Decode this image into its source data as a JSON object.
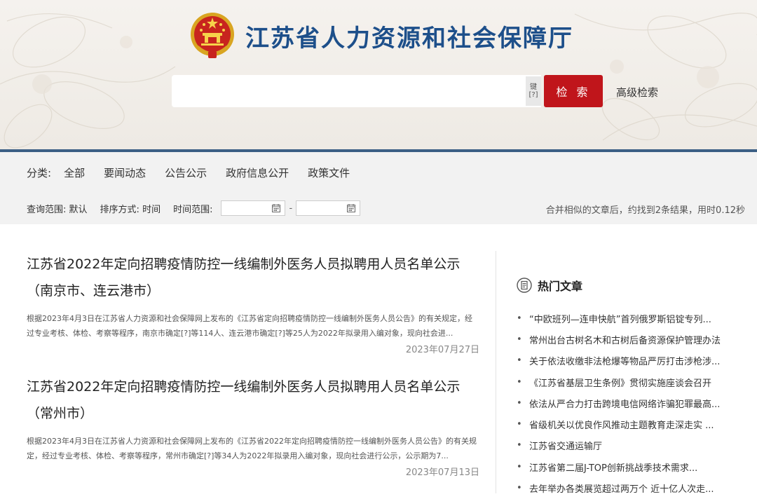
{
  "header": {
    "site_title": "江苏省人力资源和社会保障厅",
    "search_value": "",
    "keyboard_label_top": "键",
    "keyboard_label_bottom": "[?]",
    "search_button": "检 索",
    "advanced_search": "高级检索"
  },
  "filter": {
    "category_label": "分类:",
    "categories": [
      "全部",
      "要闻动态",
      "公告公示",
      "政府信息公开",
      "政策文件"
    ],
    "scope_label": "查询范围:",
    "scope_value": "默认",
    "sort_label": "排序方式:",
    "sort_value": "时间",
    "time_range_label": "时间范围:",
    "date_from": "",
    "date_to": "",
    "range_separator": "-",
    "result_summary": "合并相似的文章后，约找到2条结果，用时0.12秒"
  },
  "results": [
    {
      "title": "江苏省2022年定向招聘疫情防控一线编制外医务人员拟聘用人员名单公示（南京市、连云港市）",
      "summary": "根据2023年4月3日在江苏省人力资源和社会保障网上发布的《江苏省定向招聘疫情防控一线编制外医务人员公告》的有关规定，经过专业考核、体检、考察等程序，南京市确定[?]等114人、连云港市确定[?]等25人为2022年拟录用入编对象，现向社会进...",
      "date": "2023年07月27日"
    },
    {
      "title": "江苏省2022年定向招聘疫情防控一线编制外医务人员拟聘用人员名单公示（常州市）",
      "summary": "根据2023年4月3日在江苏省人力资源和社会保障网上发布的《江苏省2022年定向招聘疫情防控一线编制外医务人员公告》的有关规定，经过专业考核、体检、考察等程序，常州市确定[?]等34人为2022年拟录用入编对象，现向社会进行公示，公示期为7...",
      "date": "2023年07月13日"
    }
  ],
  "sidebar": {
    "hot_title": "热门文章",
    "hot_items": [
      "“中欧班列—连申快航”首列俄罗斯铝锭专列...",
      "常州出台古树名木和古树后备资源保护管理办法",
      "关于依法收缴非法枪爆等物品严厉打击涉枪涉...",
      "《江苏省基层卫生条例》贯彻实施座谈会召开",
      "依法从严合力打击跨境电信网络诈骗犯罪最高...",
      "省级机关以优良作风推动主题教育走深走实 ...",
      "江苏省交通运输厅",
      "江苏省第二届J-TOP创新挑战季技术需求...",
      "去年举办各类展览超过两万个 近十亿人次走..."
    ]
  },
  "colors": {
    "brand_blue": "#1d4f8a",
    "search_red": "#c0151b",
    "header_border": "#3c5f85"
  },
  "icons": {
    "emblem": "national-emblem-icon",
    "keyboard": "keyboard-icon",
    "calendar": "calendar-icon",
    "hot_articles": "document-list-icon"
  }
}
